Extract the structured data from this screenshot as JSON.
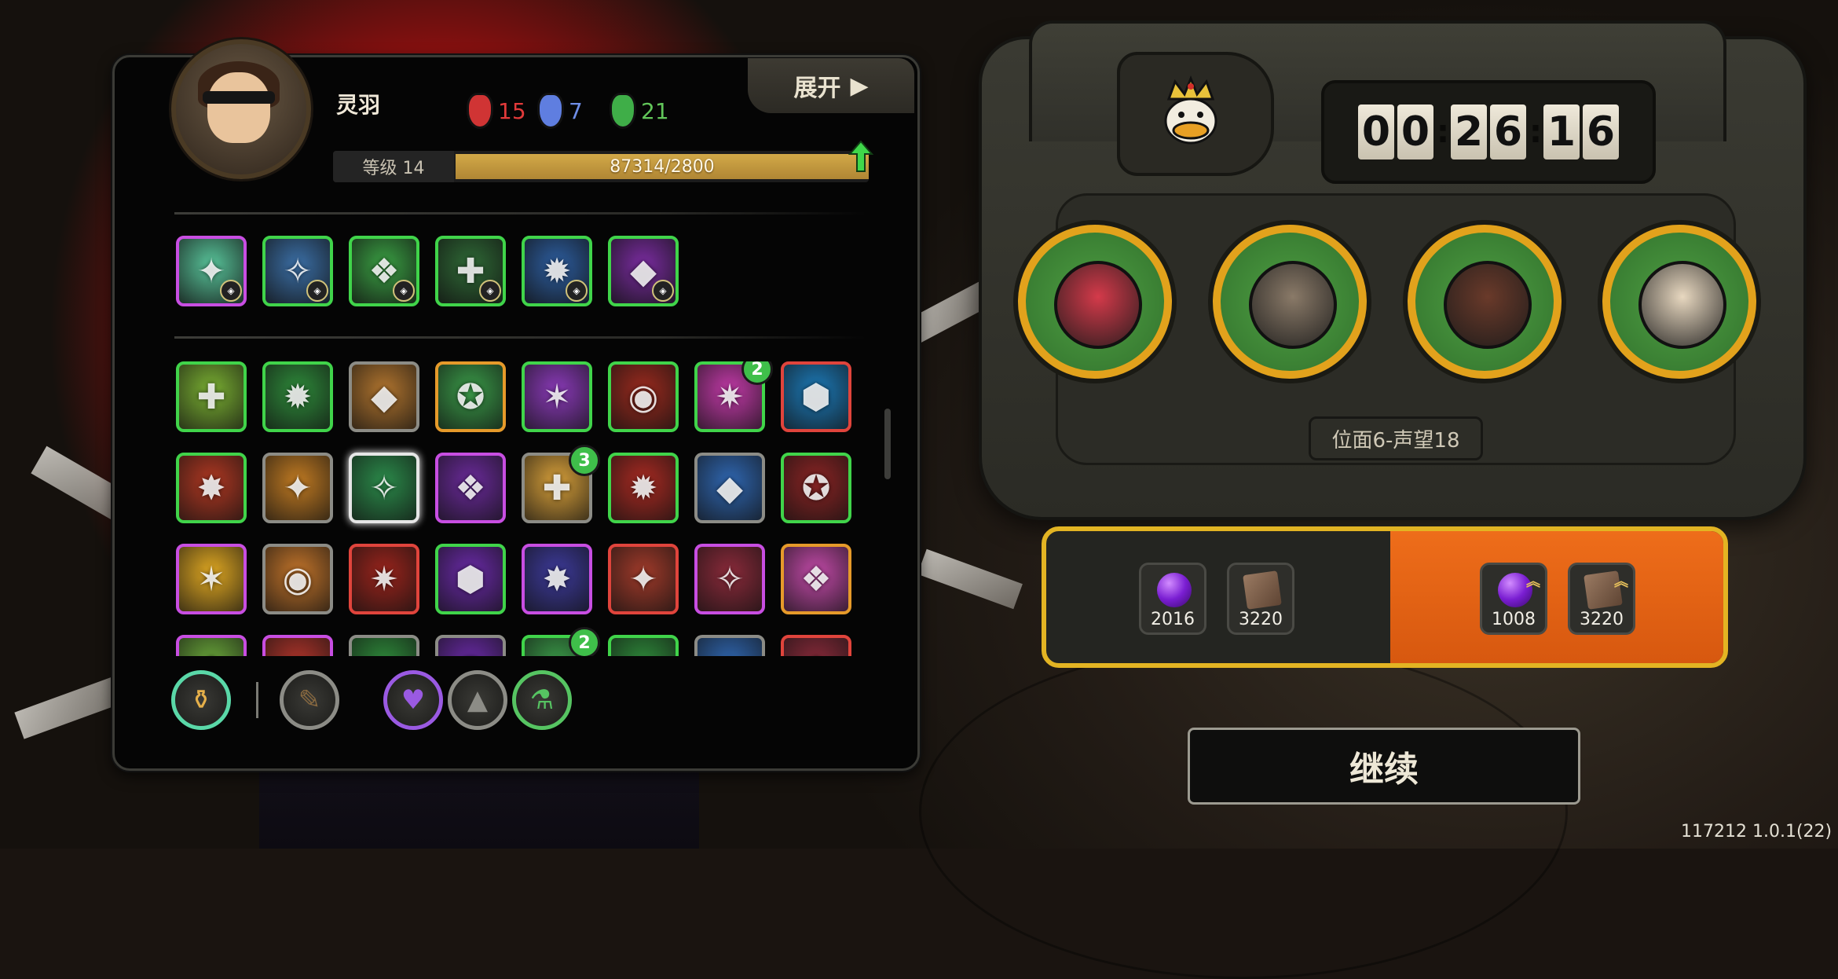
{
  "character": {
    "name": "灵羽",
    "level_label": "等级 14",
    "exp_text": "87314/2800",
    "exp_fill_percent": 100,
    "stats": [
      {
        "value": "15",
        "color": "#e23a3a",
        "icon": "red-mask-icon"
      },
      {
        "value": "7",
        "color": "#6f8ee8",
        "icon": "blue-mask-icon"
      },
      {
        "value": "21",
        "color": "#62c65a",
        "icon": "green-mask-icon"
      }
    ]
  },
  "expand_button": {
    "label": "展开"
  },
  "equipped_skills": [
    {
      "icon": "crosshair-icon",
      "border": "purple",
      "color": "#58c49a"
    },
    {
      "icon": "shield-icon",
      "border": "green",
      "color": "#3b6fa6"
    },
    {
      "icon": "claw-icon",
      "border": "green",
      "color": "#3aa043"
    },
    {
      "icon": "crest-icon",
      "border": "green",
      "color": "#2f6a36"
    },
    {
      "icon": "lightning-icon",
      "border": "green",
      "color": "#2d5ea0"
    },
    {
      "icon": "summon-icon",
      "border": "green",
      "color": "#7a2ca0"
    }
  ],
  "skills": [
    {
      "icon": "emblem-icon",
      "border": "green",
      "color": "#7ab032",
      "count": ""
    },
    {
      "icon": "spikes-icon",
      "border": "green",
      "color": "#2e8a3a",
      "count": ""
    },
    {
      "icon": "chain-icon",
      "border": "gray",
      "color": "#b0742e",
      "count": ""
    },
    {
      "icon": "tombstone-icon",
      "border": "orange",
      "color": "#3a9a48",
      "count": ""
    },
    {
      "icon": "cracks-icon",
      "border": "green",
      "color": "#8a3ab8",
      "count": ""
    },
    {
      "icon": "beast-icon",
      "border": "green",
      "color": "#9a2a1e",
      "count": ""
    },
    {
      "icon": "star-gem-icon",
      "border": "green",
      "color": "#c23aa8",
      "count": "2"
    },
    {
      "icon": "shuriken-icon",
      "border": "red",
      "color": "#1c7ab8",
      "count": ""
    },
    {
      "icon": "vortex-icon",
      "border": "green",
      "color": "#b03822",
      "count": ""
    },
    {
      "icon": "gear-ring-icon",
      "border": "gray",
      "color": "#c07a22",
      "count": ""
    },
    {
      "icon": "crystal-icon",
      "border": "white",
      "color": "#2b8a4a",
      "count": ""
    },
    {
      "icon": "chaos-icon",
      "border": "purple",
      "color": "#6a2a9a",
      "count": ""
    },
    {
      "icon": "sunrise-icon",
      "border": "gray",
      "color": "#d8a03a",
      "count": "3"
    },
    {
      "icon": "flame-icon",
      "border": "green",
      "color": "#a82a22",
      "count": ""
    },
    {
      "icon": "eye-burst-icon",
      "border": "gray",
      "color": "#2f66b0",
      "count": ""
    },
    {
      "icon": "grasp-icon",
      "border": "green",
      "color": "#8a2424",
      "count": ""
    },
    {
      "icon": "cannon-icon",
      "border": "purple",
      "color": "#e0a822",
      "count": ""
    },
    {
      "icon": "tower-icon",
      "border": "gray",
      "color": "#c2742a",
      "count": ""
    },
    {
      "icon": "axe-icon",
      "border": "red",
      "color": "#9a241c",
      "count": ""
    },
    {
      "icon": "arrow-burst-icon",
      "border": "green",
      "color": "#6a2aa8",
      "count": ""
    },
    {
      "icon": "potion-icon",
      "border": "purple",
      "color": "#3d3a9a",
      "count": ""
    },
    {
      "icon": "rune-shield-icon",
      "border": "red",
      "color": "#a03a2a",
      "count": ""
    },
    {
      "icon": "strike-icon",
      "border": "purple",
      "color": "#8a2a3a",
      "count": ""
    },
    {
      "icon": "skull-icon",
      "border": "orange",
      "color": "#c24aa8",
      "count": ""
    },
    {
      "icon": "partial-icon-1",
      "border": "purple",
      "color": "#6aa83a",
      "count": ""
    },
    {
      "icon": "partial-icon-2",
      "border": "purple",
      "color": "#b0342a",
      "count": ""
    },
    {
      "icon": "partial-icon-3",
      "border": "gray",
      "color": "#2e8a3a",
      "count": ""
    },
    {
      "icon": "partial-icon-4",
      "border": "gray",
      "color": "#6a2aa8",
      "count": ""
    },
    {
      "icon": "partial-icon-5",
      "border": "green",
      "color": "#3a9a48",
      "count": "2"
    },
    {
      "icon": "partial-icon-6",
      "border": "green",
      "color": "#2e8a3a",
      "count": ""
    },
    {
      "icon": "partial-icon-7",
      "border": "gray",
      "color": "#2f66b0",
      "count": ""
    },
    {
      "icon": "partial-icon-8",
      "border": "red",
      "color": "#8a2a3a",
      "count": ""
    }
  ],
  "tools": [
    {
      "icon": "gourd-icon",
      "ring": "#5ad8a8"
    },
    {
      "icon": "brush-icon",
      "ring": "#8c8c86"
    },
    {
      "icon": "heart-gem-icon",
      "ring": "#9a5ae2"
    },
    {
      "icon": "triangle-gem-icon",
      "ring": "#8c8c86"
    },
    {
      "icon": "flask-icon",
      "ring": "#56c462"
    }
  ],
  "timer": {
    "h": [
      "0",
      "0"
    ],
    "m": [
      "2",
      "6"
    ],
    "s": [
      "1",
      "6"
    ]
  },
  "crown_icon": "king-duck-icon",
  "bosses": [
    {
      "icon": "fly-demon-icon",
      "face_color": "#d43a4a"
    },
    {
      "icon": "masked-mech-icon",
      "face_color": "#8a7a68"
    },
    {
      "icon": "hooded-beak-icon",
      "face_color": "#6a3a2a"
    },
    {
      "icon": "afro-glasses-icon",
      "face_color": "#e8d8c0"
    }
  ],
  "stage_label": "位面6-声望18",
  "rewards": {
    "base": [
      {
        "icon": "purple-orb-icon",
        "value": "2016"
      },
      {
        "icon": "book-icon",
        "value": "3220"
      }
    ],
    "bonus": [
      {
        "icon": "purple-orb-up-icon",
        "value": "1008"
      },
      {
        "icon": "book-up-icon",
        "value": "3220"
      }
    ]
  },
  "continue_button": {
    "label": "继续"
  },
  "version": "117212 1.0.1(22)",
  "colors": {
    "panel_border": "#3b3b36",
    "gold": "#e2a21c",
    "orange": "#e6661a",
    "green": "#40d44a"
  }
}
